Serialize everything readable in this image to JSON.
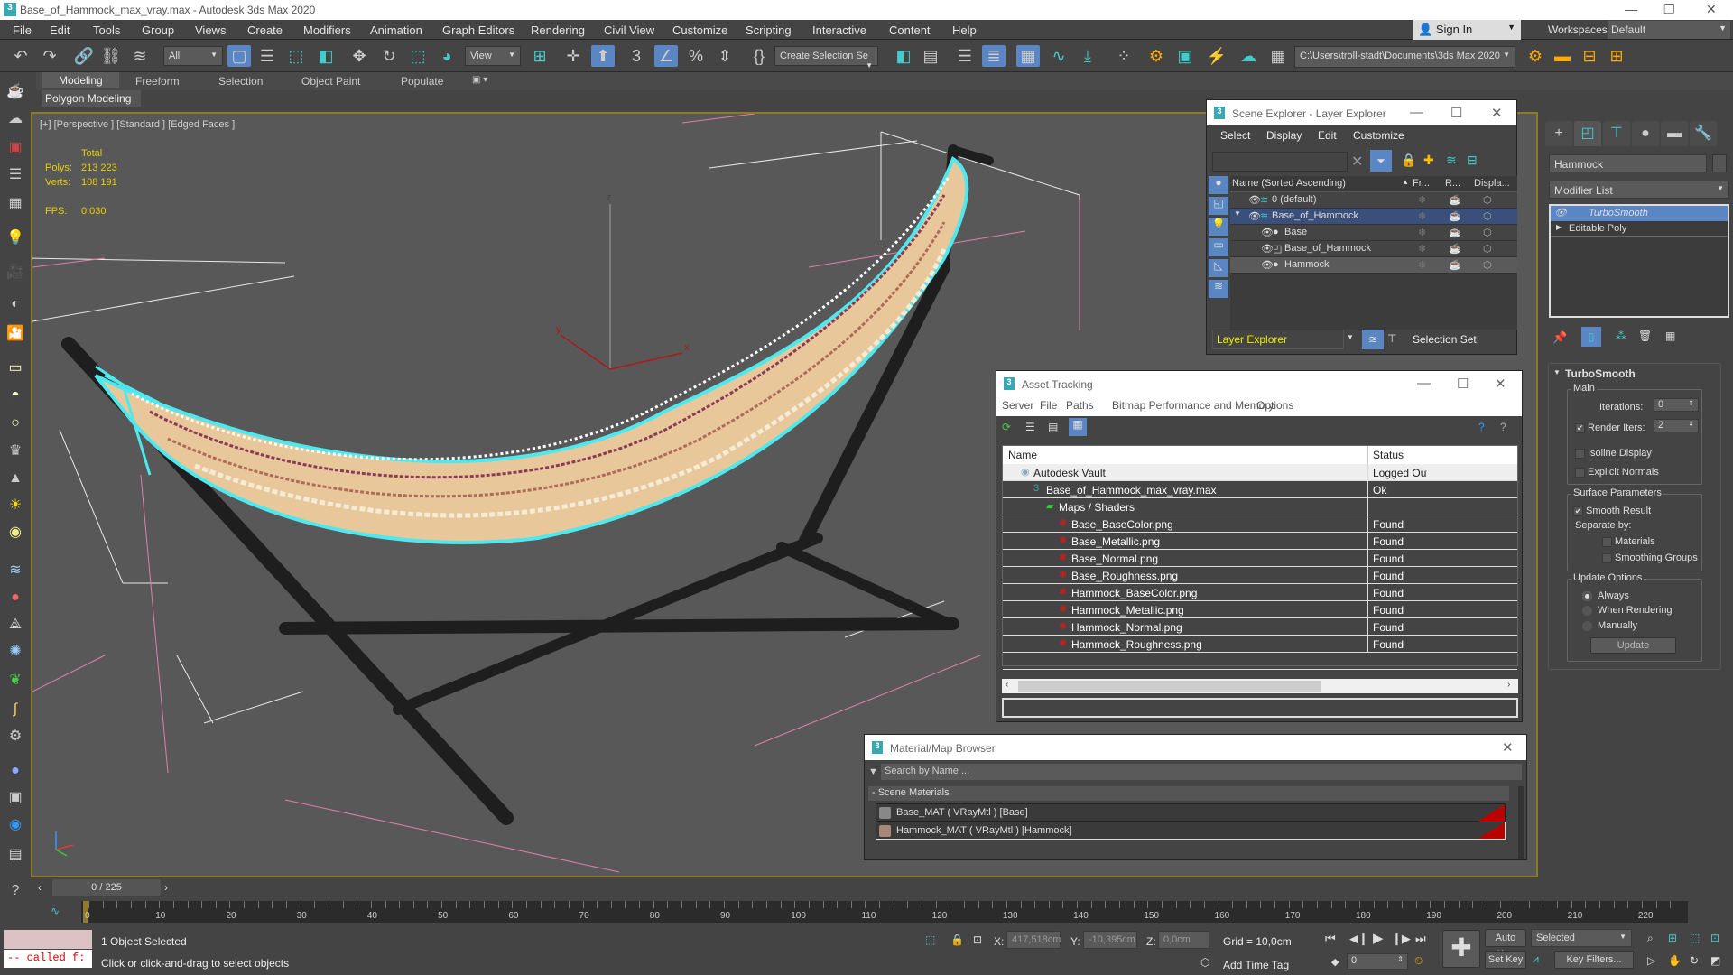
{
  "window": {
    "title": "Base_of_Hammock_max_vray.max - Autodesk 3ds Max 2020",
    "app_icon": "3"
  },
  "menu": [
    "File",
    "Edit",
    "Tools",
    "Group",
    "Views",
    "Create",
    "Modifiers",
    "Animation",
    "Graph Editors",
    "Rendering",
    "Civil View",
    "Customize",
    "Scripting",
    "Interactive",
    "Content",
    "Help"
  ],
  "account": {
    "sign_in": "Sign In",
    "workspaces_label": "Workspaces:",
    "workspace": "Default"
  },
  "toolbar": {
    "filter": "All",
    "ref_coord": "View",
    "selection_set": "Create Selection Se",
    "project_path": "C:\\Users\\troll-stadt\\Documents\\3ds Max 2020"
  },
  "ribbon": {
    "tabs": [
      "Modeling",
      "Freeform",
      "Selection",
      "Object Paint",
      "Populate"
    ],
    "active": "Modeling",
    "sub": "Polygon Modeling"
  },
  "viewport": {
    "label": "[+] [Perspective ] [Standard ] [Edged Faces ]",
    "total": "Total",
    "polys_label": "Polys:",
    "polys": "213 223",
    "verts_label": "Verts:",
    "verts": "108 191",
    "fps_label": "FPS:",
    "fps": "0,030",
    "axes": {
      "x": "x",
      "y": "y",
      "z": "z"
    }
  },
  "scene_explorer": {
    "title": "Scene Explorer - Layer Explorer",
    "menu": [
      "Select",
      "Display",
      "Edit",
      "Customize"
    ],
    "columns": [
      "Name (Sorted Ascending)",
      "Fr...",
      "R...",
      "Displa..."
    ],
    "rows": [
      {
        "name": "0 (default)",
        "level": 0,
        "type": "layer"
      },
      {
        "name": "Base_of_Hammock",
        "level": 0,
        "type": "layer",
        "selected": true
      },
      {
        "name": "Base",
        "level": 1,
        "type": "object"
      },
      {
        "name": "Base_of_Hammock",
        "level": 1,
        "type": "group"
      },
      {
        "name": "Hammock",
        "level": 1,
        "type": "object",
        "highlighted": true
      }
    ],
    "explorer_select": "Layer Explorer",
    "selection_set_label": "Selection Set:"
  },
  "asset_tracking": {
    "title": "Asset Tracking",
    "menu": [
      "Server",
      "File",
      "Paths",
      "Bitmap Performance and Memory",
      "Options"
    ],
    "columns": [
      "Name",
      "Status"
    ],
    "rows": [
      {
        "name": "Autodesk Vault",
        "status": "Logged Out (A",
        "indent": 0
      },
      {
        "name": "Base_of_Hammock_max_vray.max",
        "status": "Ok",
        "indent": 1
      },
      {
        "name": "Maps / Shaders",
        "status": "",
        "indent": 2
      },
      {
        "name": "Base_BaseColor.png",
        "status": "Found",
        "indent": 3
      },
      {
        "name": "Base_Metallic.png",
        "status": "Found",
        "indent": 3
      },
      {
        "name": "Base_Normal.png",
        "status": "Found",
        "indent": 3
      },
      {
        "name": "Base_Roughness.png",
        "status": "Found",
        "indent": 3
      },
      {
        "name": "Hammock_BaseColor.png",
        "status": "Found",
        "indent": 3
      },
      {
        "name": "Hammock_Metallic.png",
        "status": "Found",
        "indent": 3
      },
      {
        "name": "Hammock_Normal.png",
        "status": "Found",
        "indent": 3
      },
      {
        "name": "Hammock_Roughness.png",
        "status": "Found",
        "indent": 3
      }
    ]
  },
  "material_browser": {
    "title": "Material/Map Browser",
    "search_placeholder": "Search by Name ...",
    "section": "- Scene Materials",
    "items": [
      "Base_MAT ( VRayMtl ) [Base]",
      "Hammock_MAT ( VRayMtl ) [Hammock]"
    ]
  },
  "command_panel": {
    "object_name": "Hammock",
    "modifier_list": "Modifier List",
    "stack": [
      "TurboSmooth",
      "Editable Poly"
    ],
    "rollout": {
      "title": "TurboSmooth",
      "main": "Main",
      "iterations_label": "Iterations:",
      "iterations": "0",
      "render_iters_label": "Render Iters:",
      "render_iters": "2",
      "render_iters_checked": true,
      "isoline": "Isoline Display",
      "explicit": "Explicit Normals",
      "surface": "Surface Parameters",
      "smooth_result": "Smooth Result",
      "separate_by": "Separate by:",
      "materials": "Materials",
      "smoothing_groups": "Smoothing Groups",
      "update_options": "Update Options",
      "always": "Always",
      "when_rendering": "When Rendering",
      "manually": "Manually",
      "update_btn": "Update"
    }
  },
  "timeline": {
    "frame": "0 / 225",
    "ticks": [
      0,
      10,
      20,
      30,
      40,
      50,
      60,
      70,
      80,
      90,
      100,
      110,
      120,
      130,
      140,
      150,
      160,
      170,
      180,
      190,
      200,
      210,
      220
    ],
    "max": 225
  },
  "status": {
    "selected": "1 Object Selected",
    "prompt": "Click or click-and-drag to select objects",
    "script": "-- called f:",
    "x_label": "X:",
    "x": "417,518cm",
    "y_label": "Y:",
    "y": "-10,395cm",
    "z_label": "Z:",
    "z": "0,0cm",
    "grid": "Grid = 10,0cm",
    "add_time_tag": "Add Time Tag",
    "frame": "0",
    "auto_key": "Auto Key",
    "set_key": "Set Key",
    "key_mode": "Selected",
    "key_filters": "Key Filters..."
  }
}
